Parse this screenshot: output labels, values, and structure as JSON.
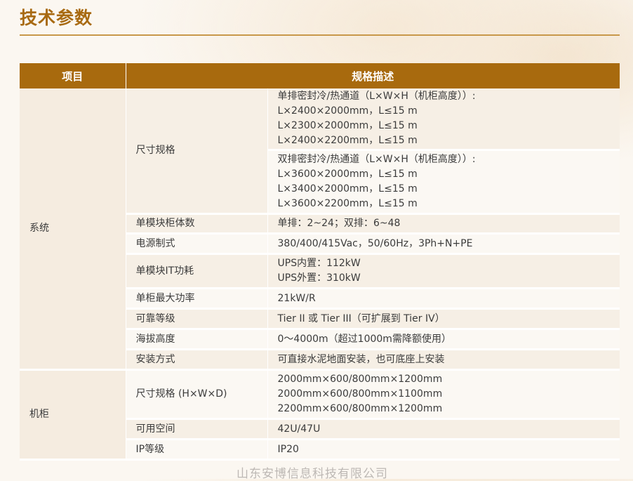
{
  "page": {
    "title": "技术参数",
    "watermark": "山东安博信息科技有限公司"
  },
  "table": {
    "headers": {
      "item": "项目",
      "spec": "规格描述"
    },
    "system": {
      "category": "系统",
      "dimension_label": "尺寸规格",
      "single_row": [
        "单排密封冷/热通道（L×W×H（机柜高度））:",
        "L×2400×2000mm，L≤15 m",
        "L×2300×2000mm，L≤15 m",
        "L×2400×2200mm，L≤15 m"
      ],
      "double_row": [
        "双排密封冷/热通道（L×W×H（机柜高度））:",
        "L×3600×2000mm，L≤15 m",
        "L×3400×2000mm，L≤15 m",
        "L×3600×2200mm，L≤15 m"
      ],
      "rows": [
        {
          "label": "单模块柜体数",
          "lines": [
            "单排：2~24；双排：6~48"
          ]
        },
        {
          "label": "电源制式",
          "lines": [
            "380/400/415Vac，50/60Hz，3Ph+N+PE"
          ]
        },
        {
          "label": "单模块IT功耗",
          "lines": [
            "UPS内置：112kW",
            "UPS外置：310kW"
          ]
        },
        {
          "label": "单柜最大功率",
          "lines": [
            "21kW/R"
          ]
        },
        {
          "label": "可靠等级",
          "lines": [
            "Tier II 或 Tier III（可扩展到 Tier IV）"
          ]
        },
        {
          "label": "海拔高度",
          "lines": [
            "0～4000m（超过1000m需降额使用）"
          ]
        },
        {
          "label": "安装方式",
          "lines": [
            "可直接水泥地面安装，也可底座上安装"
          ]
        }
      ]
    },
    "cabinet": {
      "category": "机柜",
      "rows": [
        {
          "label": "尺寸规格 (H×W×D)",
          "lines": [
            "2000mm×600/800mm×1200mm",
            "2000mm×600/800mm×1100mm",
            "2200mm×600/800mm×1200mm"
          ]
        },
        {
          "label": "可用空间",
          "lines": [
            "42U/47U"
          ]
        },
        {
          "label": "IP等级",
          "lines": [
            "IP20"
          ]
        }
      ]
    }
  }
}
